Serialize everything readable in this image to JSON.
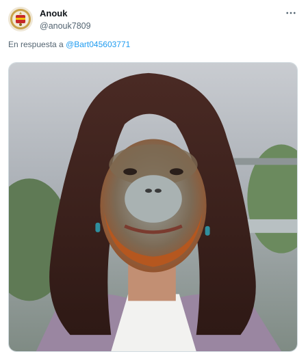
{
  "tweet": {
    "display_name": "Anouk",
    "handle": "@anouk7809",
    "reply_prefix": "En respuesta a",
    "reply_to": "@Bart045603771"
  },
  "icons": {
    "more": "more-horizontal-icon",
    "avatar": "avatar"
  },
  "colors": {
    "link": "#1d9bf0",
    "secondary_text": "#536471",
    "border": "#cfd9de"
  }
}
